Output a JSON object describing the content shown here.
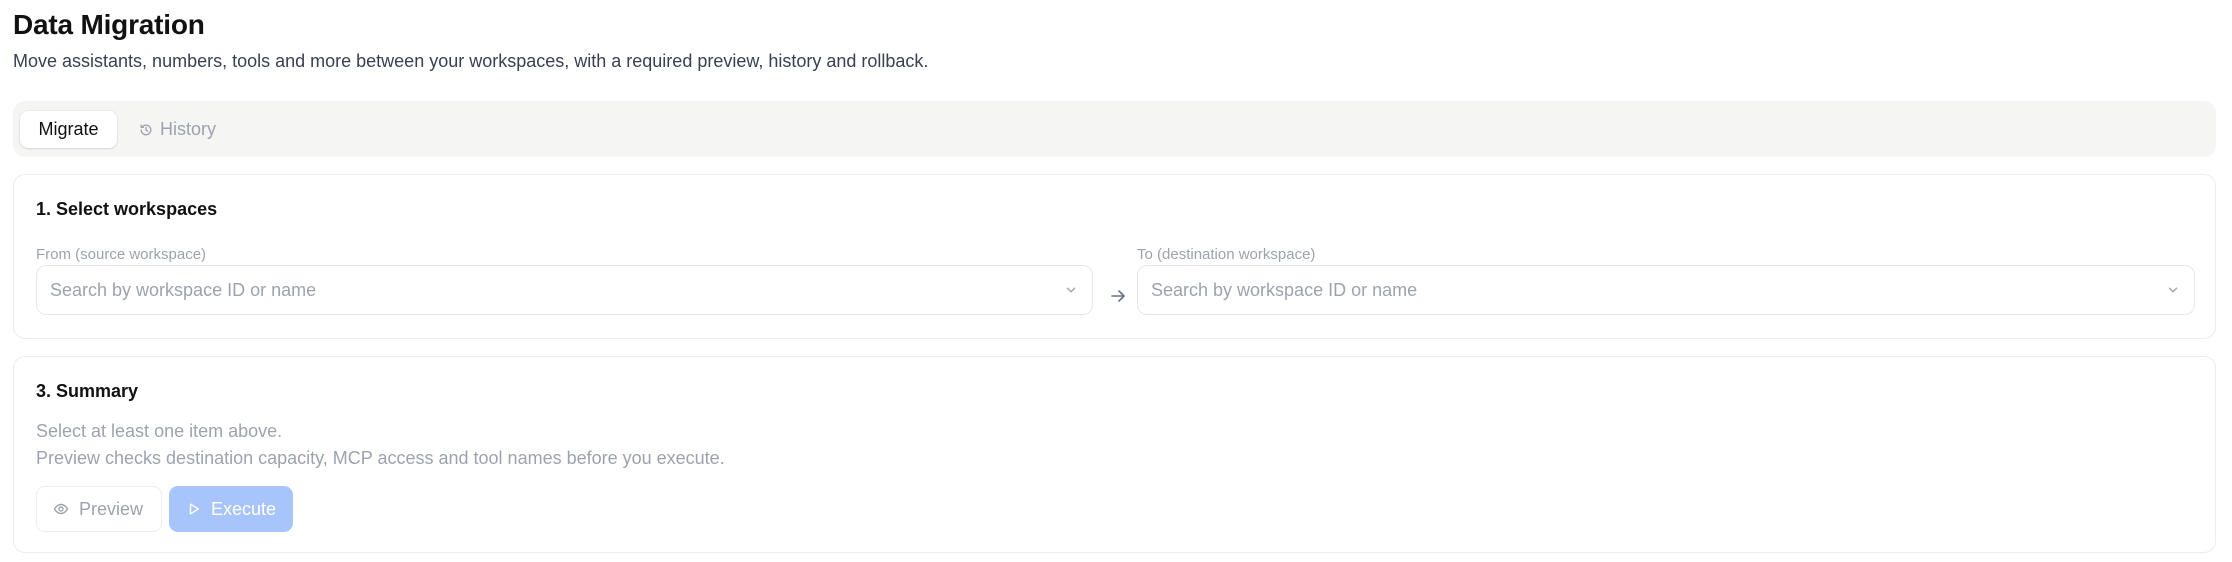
{
  "header": {
    "title": "Data Migration",
    "subtitle": "Move assistants, numbers, tools and more between your workspaces, with a required preview, history and rollback."
  },
  "tabs": [
    {
      "label": "Migrate",
      "active": true
    },
    {
      "label": "History",
      "active": false,
      "icon": "history-icon"
    }
  ],
  "workspaces": {
    "title": "1. Select workspaces",
    "from": {
      "label": "From (source workspace)",
      "placeholder": "Search by workspace ID or name",
      "value": ""
    },
    "to": {
      "label": "To (destination workspace)",
      "placeholder": "Search by workspace ID or name",
      "value": ""
    },
    "separator_icon": "arrow-right-icon"
  },
  "summary": {
    "title": "3. Summary",
    "empty_text": "Select at least one item above.",
    "help_text": "Preview checks destination capacity, MCP access and tool names before you execute.",
    "preview_label": "Preview",
    "preview_icon": "eye-icon",
    "execute_label": "Execute",
    "execute_icon": "play-icon",
    "execute_disabled": true
  },
  "colors": {
    "accent_disabled": "#a8c5fb",
    "tabbar_bg": "#f5f5f4",
    "muted_text": "#9ca3af"
  }
}
